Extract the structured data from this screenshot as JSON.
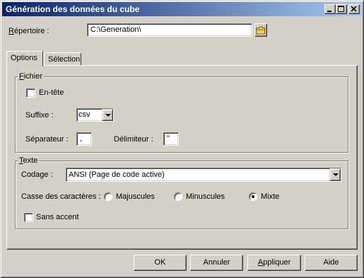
{
  "window": {
    "title": "Génération des données du cube",
    "controls": [
      "minimize-icon",
      "maximize-icon",
      "close-icon"
    ]
  },
  "directory": {
    "label": "Répertoire :",
    "value": "C:\\Generation\\",
    "browse_icon": "folder-icon"
  },
  "tabs": [
    {
      "label": "Options",
      "active": true
    },
    {
      "label": "Sélection",
      "active": false
    }
  ],
  "fichier": {
    "group_title": "Fichier",
    "header_checkbox": {
      "label": "En-tête",
      "checked": false
    },
    "suffix": {
      "label": "Suffixe :",
      "value": "csv"
    },
    "separator": {
      "label": "Séparateur :",
      "value": ","
    },
    "delimiter": {
      "label": "Délimiteur :",
      "value": "\""
    }
  },
  "texte": {
    "group_title": "Texte",
    "encoding": {
      "label": "Codage :",
      "value": "ANSI (Page de code active)"
    },
    "case": {
      "label": "Casse des caractères :",
      "options": [
        {
          "label": "Majuscules",
          "selected": false
        },
        {
          "label": "Minuscules",
          "selected": false
        },
        {
          "label": "Mixte",
          "selected": true
        }
      ]
    },
    "no_accent_checkbox": {
      "label": "Sans accent",
      "checked": false
    }
  },
  "buttons": {
    "ok": "OK",
    "cancel": "Annuler",
    "apply": "Appliquer",
    "help": "Aide"
  }
}
